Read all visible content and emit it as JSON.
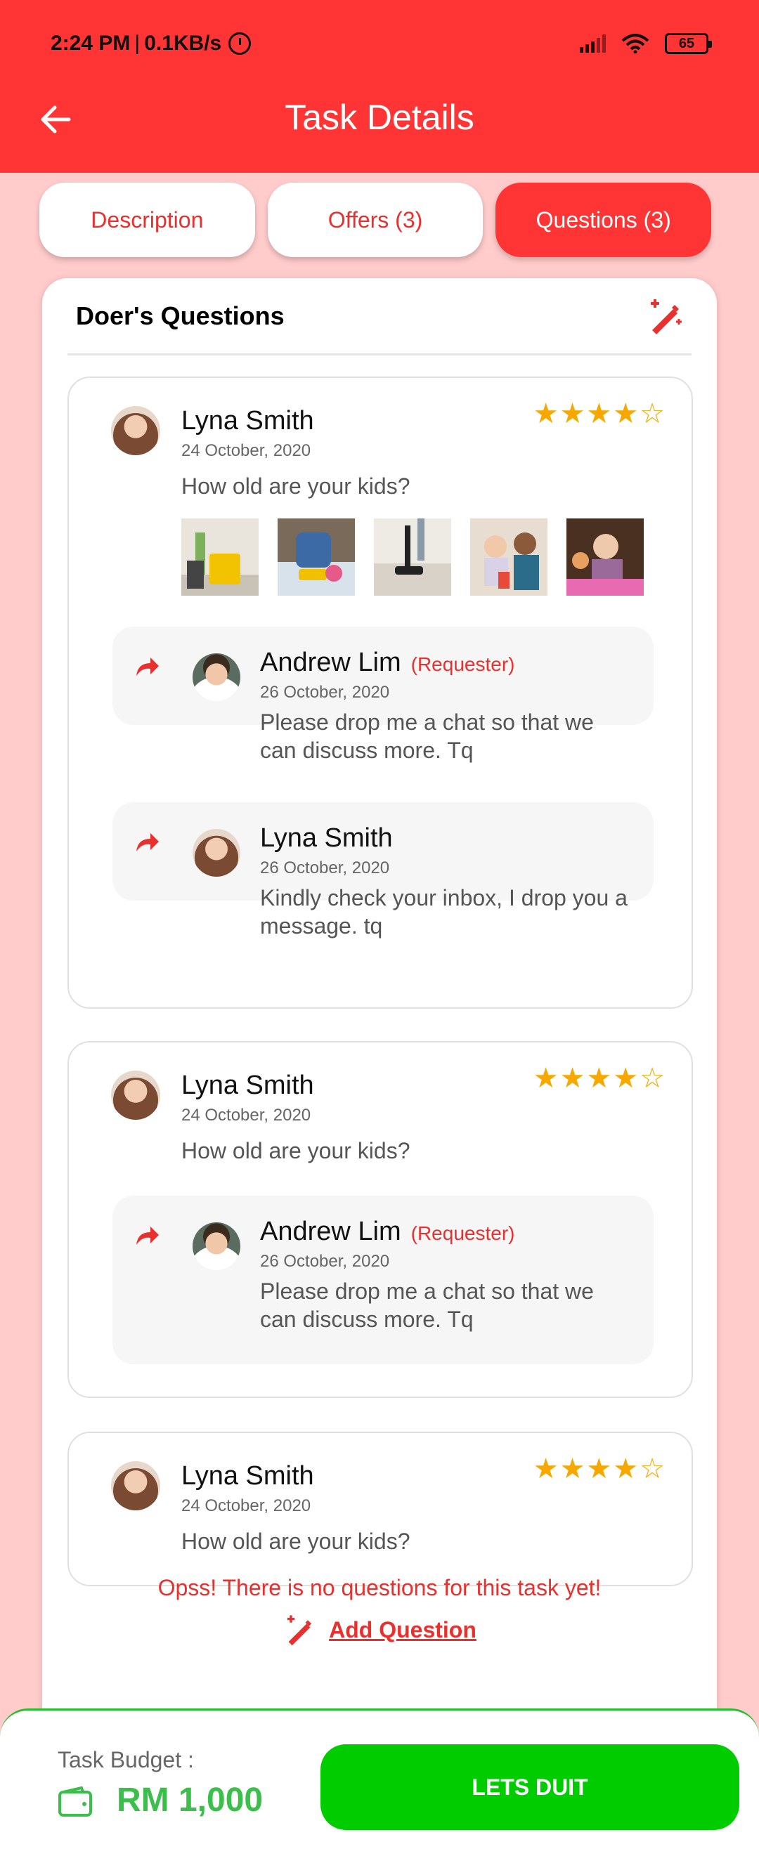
{
  "status": {
    "time": "2:24 PM",
    "speed": "0.1KB/s",
    "battery": "65"
  },
  "header": {
    "title": "Task Details"
  },
  "tabs": [
    {
      "label": "Description"
    },
    {
      "label": "Offers (3)"
    },
    {
      "label": "Questions (3)"
    }
  ],
  "card": {
    "title": "Doer's Questions"
  },
  "questions": [
    {
      "name": "Lyna Smith",
      "date": "24 October, 2020",
      "text": "How old are your kids?",
      "stars": "★★★★☆",
      "rating": 4,
      "replies": [
        {
          "name": "Andrew Lim",
          "tag": "(Requester)",
          "date": "26 October, 2020",
          "text": "Please drop me a chat so that we can discuss more. Tq"
        },
        {
          "name": "Lyna Smith",
          "date": "26 October, 2020",
          "text": "Kindly check your inbox, I drop you a message. tq"
        }
      ]
    },
    {
      "name": "Lyna Smith",
      "date": "24 October, 2020",
      "text": "How old are your kids?",
      "stars": "★★★★☆",
      "rating": 4,
      "replies": [
        {
          "name": "Andrew Lim",
          "tag": "(Requester)",
          "date": "26 October, 2020",
          "text": "Please drop me a chat so that we can discuss more. Tq"
        }
      ]
    },
    {
      "name": "Lyna Smith",
      "date": "24 October, 2020",
      "text": "How old are your kids?",
      "stars": "★★★★☆",
      "rating": 4
    }
  ],
  "empty_message": "Opss! There is no questions for this task yet!",
  "add_question_label": "Add Question",
  "footer": {
    "budget_label": "Task Budget :",
    "budget_value": "RM 1,000",
    "cta_label": "LETS DUIT"
  },
  "colors": {
    "primary": "#ff3535",
    "background": "#ffcbcb",
    "star": "#f6a800",
    "cta": "#00cc00",
    "budget": "#3ac04a"
  },
  "icons": {
    "back": "arrow-left-icon",
    "edit": "magic-pen-icon",
    "reply": "reply-arrow-icon",
    "wallet": "wallet-icon"
  }
}
